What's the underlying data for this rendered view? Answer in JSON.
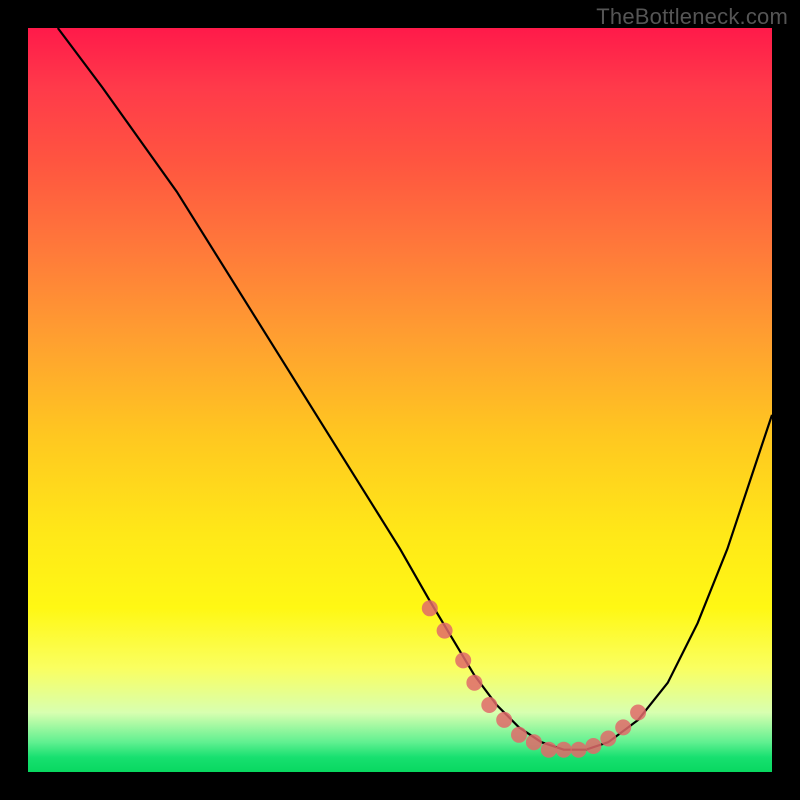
{
  "watermark": "TheBottleneck.com",
  "chart_data": {
    "type": "line",
    "title": "",
    "xlabel": "",
    "ylabel": "",
    "xlim": [
      0,
      100
    ],
    "ylim": [
      0,
      100
    ],
    "grid": false,
    "legend": false,
    "curve": {
      "name": "bottleneck-curve",
      "color": "#000000",
      "x": [
        4,
        10,
        15,
        20,
        25,
        30,
        35,
        40,
        45,
        50,
        54,
        57,
        60,
        63,
        66,
        69,
        72,
        75,
        78,
        82,
        86,
        90,
        94,
        98,
        100
      ],
      "y": [
        100,
        92,
        85,
        78,
        70,
        62,
        54,
        46,
        38,
        30,
        23,
        18,
        13,
        9,
        6,
        4,
        3,
        3,
        4,
        7,
        12,
        20,
        30,
        42,
        48
      ]
    },
    "markers": {
      "name": "highlight-points",
      "color": "#e06a6a",
      "radius": 8,
      "x": [
        54,
        56,
        58.5,
        60,
        62,
        64,
        66,
        68,
        70,
        72,
        74,
        76,
        78,
        80,
        82
      ],
      "y": [
        22,
        19,
        15,
        12,
        9,
        7,
        5,
        4,
        3,
        3,
        3,
        3.5,
        4.5,
        6,
        8
      ]
    }
  },
  "colors": {
    "background": "#000000",
    "curve": "#000000",
    "marker": "#e06a6a",
    "watermark": "#555555"
  }
}
